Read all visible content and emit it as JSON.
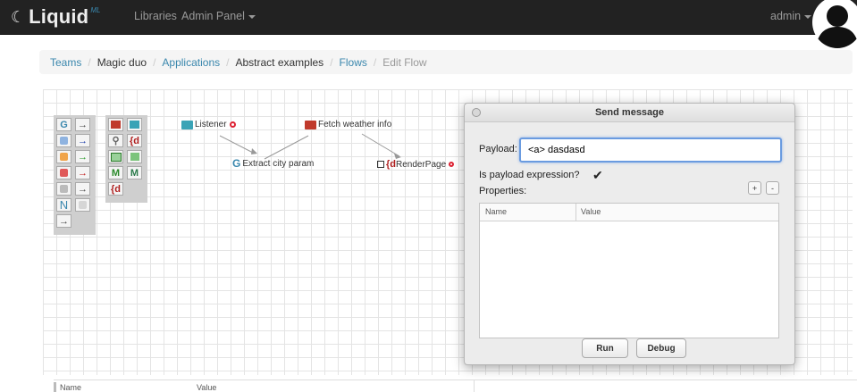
{
  "navbar": {
    "brand_icon": "liquid-swirl-icon",
    "brand_name": "Liquid",
    "brand_sup": "ML",
    "libraries": "Libraries",
    "admin_panel": "Admin Panel",
    "user": "admin",
    "background": "#222222"
  },
  "breadcrumb": {
    "teams": "Teams",
    "magic_duo": "Magic duo",
    "applications": "Applications",
    "abstract_examples": "Abstract examples",
    "flows": "Flows",
    "edit_flow": "Edit Flow",
    "separator": "/",
    "link_color": "#3a87ad"
  },
  "palette": {
    "tools": [
      "G",
      "→",
      "→",
      "→",
      "→",
      "→",
      "N",
      "→",
      "{d",
      "M",
      "M",
      "{d"
    ]
  },
  "flow_nodes": {
    "listener": "Listener",
    "fetch_weather": "Fetch weather info",
    "extract_city": "Extract city param",
    "extract_icon": "G",
    "render_page": "RenderPage",
    "render_icon": "{d"
  },
  "dialog": {
    "title": "Send message",
    "payload_label": "Payload:",
    "payload_value": "<a> dasdasd",
    "expr_label": "Is payload expression?",
    "expr_checked": "✔",
    "properties_label": "Properties:",
    "plus": "+",
    "minus": "-",
    "columns": [
      "Name",
      "Value"
    ],
    "run": "Run",
    "debug": "Debug"
  },
  "bottom_table": {
    "columns": [
      "Name",
      "Value"
    ]
  }
}
